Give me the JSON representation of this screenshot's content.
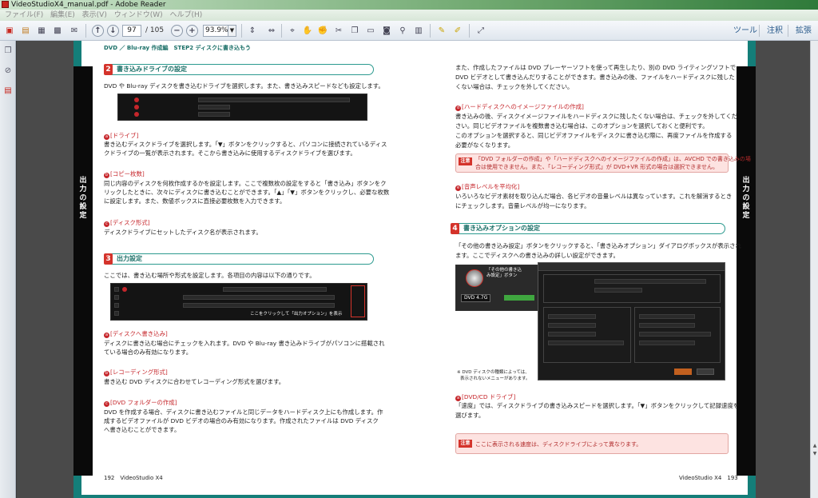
{
  "window": {
    "title": "VideoStudioX4_manual.pdf - Adobe Reader"
  },
  "menu": [
    "ファイル(F)",
    "編集(E)",
    "表示(V)",
    "ウィンドウ(W)",
    "ヘルプ(H)"
  ],
  "toolbar": {
    "page_current": "97",
    "page_total": "/ 105",
    "zoom": "93.9%",
    "tools_label": "ツール",
    "comment_label": "注釈",
    "extend_label": "拡張"
  },
  "left": {
    "header": "DVD ／ Blu-ray 作成編　STEP2 ディスクに書き込もう",
    "sec2_num": "2",
    "sec2_title": "書き込みドライブの設定",
    "sec2_intro": "DVD や Blu-ray ディスクを書き込むドライブを選択します。また、書き込みスピードなども設定します。",
    "sub_drive": "[ドライブ]",
    "drive_1": "書き込むディスクドライブを選択します。「▼」ボタンをクリックすると、パソコンに接続されているディス",
    "drive_2": "クドライブの一覧が表示されます。そこから書き込みに使用するディスクドライブを選びます。",
    "sub_copies": "[コピー枚数]",
    "copies_1": "同じ内容のディスクを何枚作成するかを設定します。ここで複数枚の設定をすると「書き込み」ボタンをク",
    "copies_2": "リックしたときに、次々にディスクに書き込むことができます。「▲」「▼」ボタンをクリックし、必要な枚数",
    "copies_3": "に設定します。また、数値ボックスに直接必要枚数を入力できます。",
    "sub_format": "[ディスク形式]",
    "format_1": "ディスクドライブにセットしたディスク名が表示されます。",
    "sec3_num": "3",
    "sec3_title": "出力設定",
    "sec3_intro": "ここでは、書き込む場所や形式を設定します。各項目の内容は以下の通りです。",
    "shot2_caption": "ここをクリックして「出力オプション」を表示",
    "sub_towrite": "[ディスクへ書き込み]",
    "towrite_1": "ディスクに書き込む場合にチェックを入れます。DVD や Blu-ray 書き込みドライブがパソコンに搭載され",
    "towrite_2": "ている場合のみ有効になります。",
    "sub_recfmt": "[レコーディング形式]",
    "recfmt_1": "書き込む DVD ディスクに合わせてレコーディング形式を選びます。",
    "sub_folder": "[DVD フォルダーの作成]",
    "folder_1": "DVD を作成する場合、ディスクに書き込むファイルと同じデータをハードディスク上にも作成します。作",
    "folder_2": "成するビデオファイルが DVD ビデオの場合のみ有効になります。作成されたファイルは DVD ディスク",
    "folder_3": "へ書き込むことができます。",
    "page_label": "192　VideoStudio X4",
    "side_label": "出力の設定"
  },
  "right": {
    "intro_1": "また、作成したファイルは DVD プレーヤーソフトを使って再生したり、別の DVD ライティングソフトで",
    "intro_2": "DVD ビデオとして書き込んだりすることができます。書き込みの後、ファイルをハードディスクに残した",
    "intro_3": "くない場合は、チェックを外してください。",
    "sub_image": "[ハードディスクへのイメージファイルの作成]",
    "image_1": "書き込みの後、ディスクイメージファイルをハードディスクに残したくない場合は、チェックを外してくだ",
    "image_2": "さい。同じビデオファイルを複数書き込む場合は、このオプションを選択しておくと便利です。",
    "image_3": "このオプションを選択すると、同じビデオファイルをディスクに書き込む際に、再度ファイルを作成する",
    "image_4": "必要がなくなります。",
    "note1_tag": "注意",
    "note1_1": "「DVD フォルダーの作成」や「ハードディスクへのイメージファイルの作成」は、AVCHD での書き込みの場",
    "note1_2": "合は使用できません。また、「レコーディング形式」が DVD+VR 形式の場合は選択できません。",
    "sub_audio": "[音声レベルを平均化]",
    "audio_1": "いろいろなビデオ素材を取り込んだ場合、各ビデオの音量レベルは異なっています。これを解消するとき",
    "audio_2": "にチェックします。音量レベルが均一になります。",
    "sec4_num": "4",
    "sec4_title": "書き込みオプションの設定",
    "sec4_1": "「その他の書き込み設定」ボタンをクリックすると、「書き込みオプション」ダイアログボックスが表示され",
    "sec4_2": "ます。ここでディスクへの書き込みの詳しい設定ができます。",
    "callout": "「その他の書き込み設定」ボタン",
    "dvd_label": "DVD 4.7G",
    "small_1": "※ DVD ディスクの種類によっては、",
    "small_2": "表示されないメニューがあります。",
    "sub_dvdcd": "[DVD/CD ドライブ]",
    "dvdcd_1": "「速度」では、ディスクドライブの書き込みスピードを選択します。「▼」ボタンをクリックして記録速度を",
    "dvdcd_2": "選びます。",
    "note2_tag": "注意",
    "note2_1": "ここに表示される速度は、ディスクドライブによって異なります。",
    "page_label": "VideoStudio X4　193",
    "side_label": "出力の設定"
  }
}
